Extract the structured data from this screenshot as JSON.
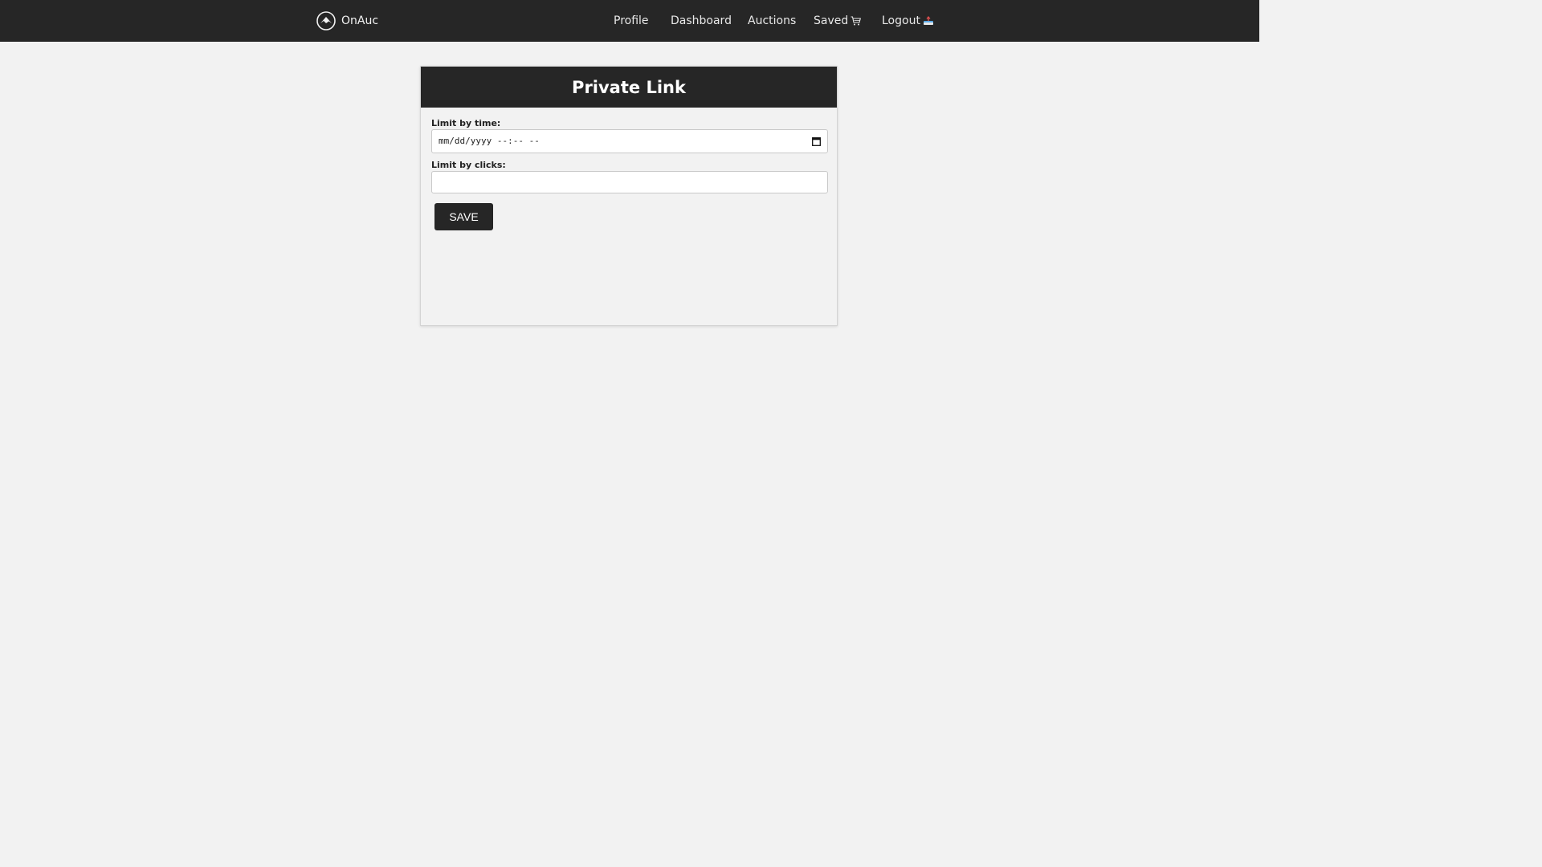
{
  "nav": {
    "brand": "OnAuc",
    "links": [
      {
        "label": "Profile"
      },
      {
        "label": "Dashboard"
      },
      {
        "label": "Auctions"
      },
      {
        "label": "Saved",
        "icon": "cart-icon"
      },
      {
        "label": "Logout",
        "icon": "logout-icon"
      }
    ]
  },
  "card": {
    "title": "Private Link",
    "time_label": "Limit by time:",
    "time_value": "mm/dd/yyyy --:-- --",
    "clicks_label": "Limit by clicks:",
    "clicks_value": "",
    "save_label": "SAVE"
  },
  "colors": {
    "nav_bg": "#262626",
    "page_bg": "#f2f2f2",
    "button_bg": "#262626"
  }
}
